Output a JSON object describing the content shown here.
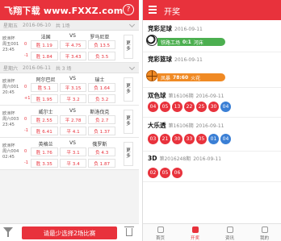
{
  "left": {
    "watermark": "飞翔下载 www.FXXZ.com",
    "help_icon": "question-circle-icon",
    "days": [
      {
        "weekday": "星期五",
        "date": "2016-06-10",
        "count": "共 1场",
        "matches": [
          {
            "league": "欧洲杯",
            "code": "周五001",
            "time": "23:45",
            "home": "法国",
            "vs": "VS",
            "away": "罗马尼亚",
            "row1_idx": "0",
            "row1": [
              "胜 1.19",
              "平 4.75",
              "负 13.5"
            ],
            "row2_idx": "-1",
            "row2": [
              "胜 1.84",
              "平 3.43",
              "负 3.5"
            ],
            "more": "更多"
          }
        ]
      },
      {
        "weekday": "星期六",
        "date": "2016-06-11",
        "count": "共 3 场",
        "matches": [
          {
            "league": "欧洲杯",
            "code": "周六001",
            "time": "20:45",
            "home": "阿尔巴尼",
            "vs": "VS",
            "away": "瑞士",
            "row1_idx": "0",
            "row1": [
              "胜 5.1",
              "平 3.15",
              "负 1.64"
            ],
            "row2_idx": "+1",
            "row2": [
              "胜 1.95",
              "平 3.2",
              "负 3.2"
            ],
            "more": "更多"
          },
          {
            "league": "欧洲杯",
            "code": "周六003",
            "time": "23:45",
            "home": "威尔士",
            "vs": "VS",
            "away": "斯洛伐克",
            "row1_idx": "0",
            "row1": [
              "胜 2.55",
              "平 2.78",
              "负 2.7"
            ],
            "row2_idx": "-1",
            "row2": [
              "胜 6.41",
              "平 4.1",
              "负 1.37"
            ],
            "more": "更多"
          },
          {
            "league": "欧洲杯",
            "code": "周六004",
            "time": "02:45",
            "home": "英格兰",
            "vs": "VS",
            "away": "俄罗斯",
            "row1_idx": "0",
            "row1": [
              "胜 1.76",
              "平 3.1",
              "负 4.3"
            ],
            "row2_idx": "-1",
            "row2": [
              "胜 3.35",
              "平 3.4",
              "负 1.87"
            ],
            "more": "更多"
          }
        ]
      }
    ],
    "footer": {
      "filter_icon": "filter-icon",
      "cta": "请最少选择2场比赛",
      "trash_icon": "trash-icon"
    }
  },
  "right": {
    "header": {
      "menu_icon": "menu-icon",
      "title": "开奖"
    },
    "football": {
      "name": "竞彩足球",
      "date": "2016-09-11",
      "home": "铁路工场",
      "score": "0:1",
      "away": "河床"
    },
    "basketball": {
      "name": "竞彩篮球",
      "date": "2016-09-11",
      "home": "凤暴",
      "score": "78:60",
      "away": "火花"
    },
    "ssq": {
      "name": "双色球",
      "issue": "第16106期",
      "date": "2016-09-11",
      "red": [
        "04",
        "05",
        "13",
        "22",
        "25",
        "30"
      ],
      "blue": [
        "04"
      ]
    },
    "dlt": {
      "name": "大乐透",
      "issue": "第16106期",
      "date": "2016-09-11",
      "red": [
        "03",
        "21",
        "30",
        "33",
        "35"
      ],
      "blue": [
        "01",
        "04"
      ]
    },
    "fc3d": {
      "name": "3D",
      "issue": "第2016248期",
      "date": "2016-09-11",
      "red": [
        "02",
        "05",
        "06"
      ]
    },
    "footer_tabs": [
      {
        "label": "首页",
        "active": false
      },
      {
        "label": "开奖",
        "active": true
      },
      {
        "label": "资讯",
        "active": false
      },
      {
        "label": "我的",
        "active": false
      }
    ]
  },
  "colors": {
    "brand_red": "#e8323c",
    "ball_blue": "#3a7fd5",
    "football_green": "#4caf50",
    "basketball_orange": "#f08a24"
  }
}
